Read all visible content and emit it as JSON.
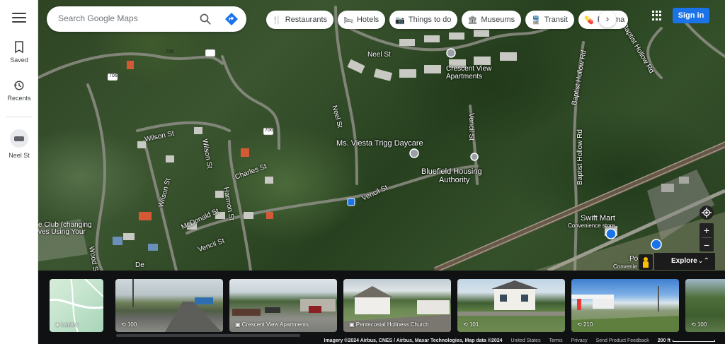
{
  "search": {
    "placeholder": "Search Google Maps"
  },
  "rail": {
    "menu_icon": "menu-icon",
    "items": [
      {
        "label": "Saved",
        "icon": "bookmark-icon"
      },
      {
        "label": "Recents",
        "icon": "history-icon"
      },
      {
        "label": "Neel St",
        "icon": "street-thumbnail"
      }
    ]
  },
  "categories": [
    {
      "label": "Restaurants",
      "icon": "restaurant-icon"
    },
    {
      "label": "Hotels",
      "icon": "hotel-icon"
    },
    {
      "label": "Things to do",
      "icon": "camera-icon"
    },
    {
      "label": "Museums",
      "icon": "museum-icon"
    },
    {
      "label": "Transit",
      "icon": "transit-icon"
    },
    {
      "label": "Pharma",
      "icon": "pharmacy-icon"
    }
  ],
  "header": {
    "sign_in": "Sign in",
    "brand_color": "#1a73e8"
  },
  "map_labels": {
    "neel_st_top": "Neel St",
    "neel_st_vertical": "Neel St",
    "crescent_line1": "Crescent View",
    "crescent_line2": "Apartments",
    "baptist_hollow_rd": "Baptist Hollow Rd",
    "baptist_hollow_rd_2": "Baptist Hollow Rd",
    "baptist_hollow_rd_3": "Baptist Hollow Rd",
    "road_706_a": "706",
    "road_706_b": "706",
    "road_706_c": "706",
    "wilson_st": "Wilson St",
    "wilson_st_vertical": "Wilson St",
    "wilson_st_lower": "Wilson St",
    "charles_st": "Charles St",
    "harmon_st": "Harmon St",
    "mcdonald_st": "McDonald St",
    "vencil_st_low": "Vencil St",
    "vencil_st_mid": "Vencil St",
    "vencil_st_vertical": "Vencil St",
    "daycare": "Ms. Viesta Trigg Daycare",
    "housing_line1": "Bluefield Housing",
    "housing_line2": "Authority",
    "swift_mart": "Swift Mart",
    "swift_mart_sub": "Convenience store",
    "club_line1": "e Club (changing",
    "club_line2": "ves Using Your",
    "wood_st": "Wood S",
    "po_label": "Po",
    "po_sub": "Convenie",
    "de_label": "De"
  },
  "controls": {
    "explore": "Explore",
    "zoom_in": "+",
    "zoom_out": "−"
  },
  "strip": {
    "cards": [
      {
        "caption": "Layers",
        "icon": "layers-icon"
      },
      {
        "caption": "100",
        "icon": "360-icon"
      },
      {
        "caption": "Crescent View Apartments",
        "icon": "photo-icon"
      },
      {
        "caption": "Pentecostal Holiness Church",
        "icon": "photo-icon"
      },
      {
        "caption": "101",
        "icon": "360-icon"
      },
      {
        "caption": "210",
        "icon": "360-icon"
      },
      {
        "caption": "100",
        "icon": "360-icon"
      }
    ]
  },
  "footer": {
    "imagery": "Imagery ©2024 Airbus, CNES / Airbus, Maxar Technologies, Map data ©2024",
    "country": "United States",
    "terms": "Terms",
    "privacy": "Privacy",
    "feedback": "Send Product Feedback",
    "scale": "200 ft"
  }
}
